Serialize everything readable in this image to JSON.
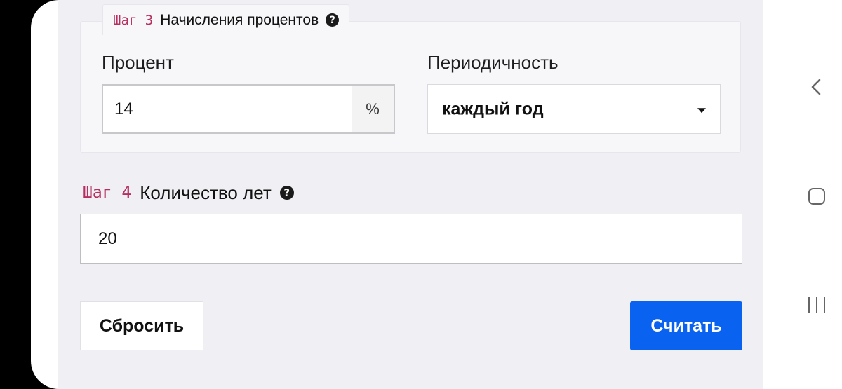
{
  "step3": {
    "code": "Шаг 3",
    "title": "Начисления процентов",
    "percent_label": "Процент",
    "percent_value": "14",
    "percent_unit": "%",
    "period_label": "Периодичность",
    "period_value": "каждый год"
  },
  "step4": {
    "code": "Шаг 4",
    "title": "Количество лет",
    "years_value": "20"
  },
  "buttons": {
    "reset": "Сбросить",
    "calculate": "Считать"
  },
  "icons": {
    "help": "?"
  },
  "colors": {
    "accent": "#0a63f0",
    "step_code": "#b5305f"
  }
}
